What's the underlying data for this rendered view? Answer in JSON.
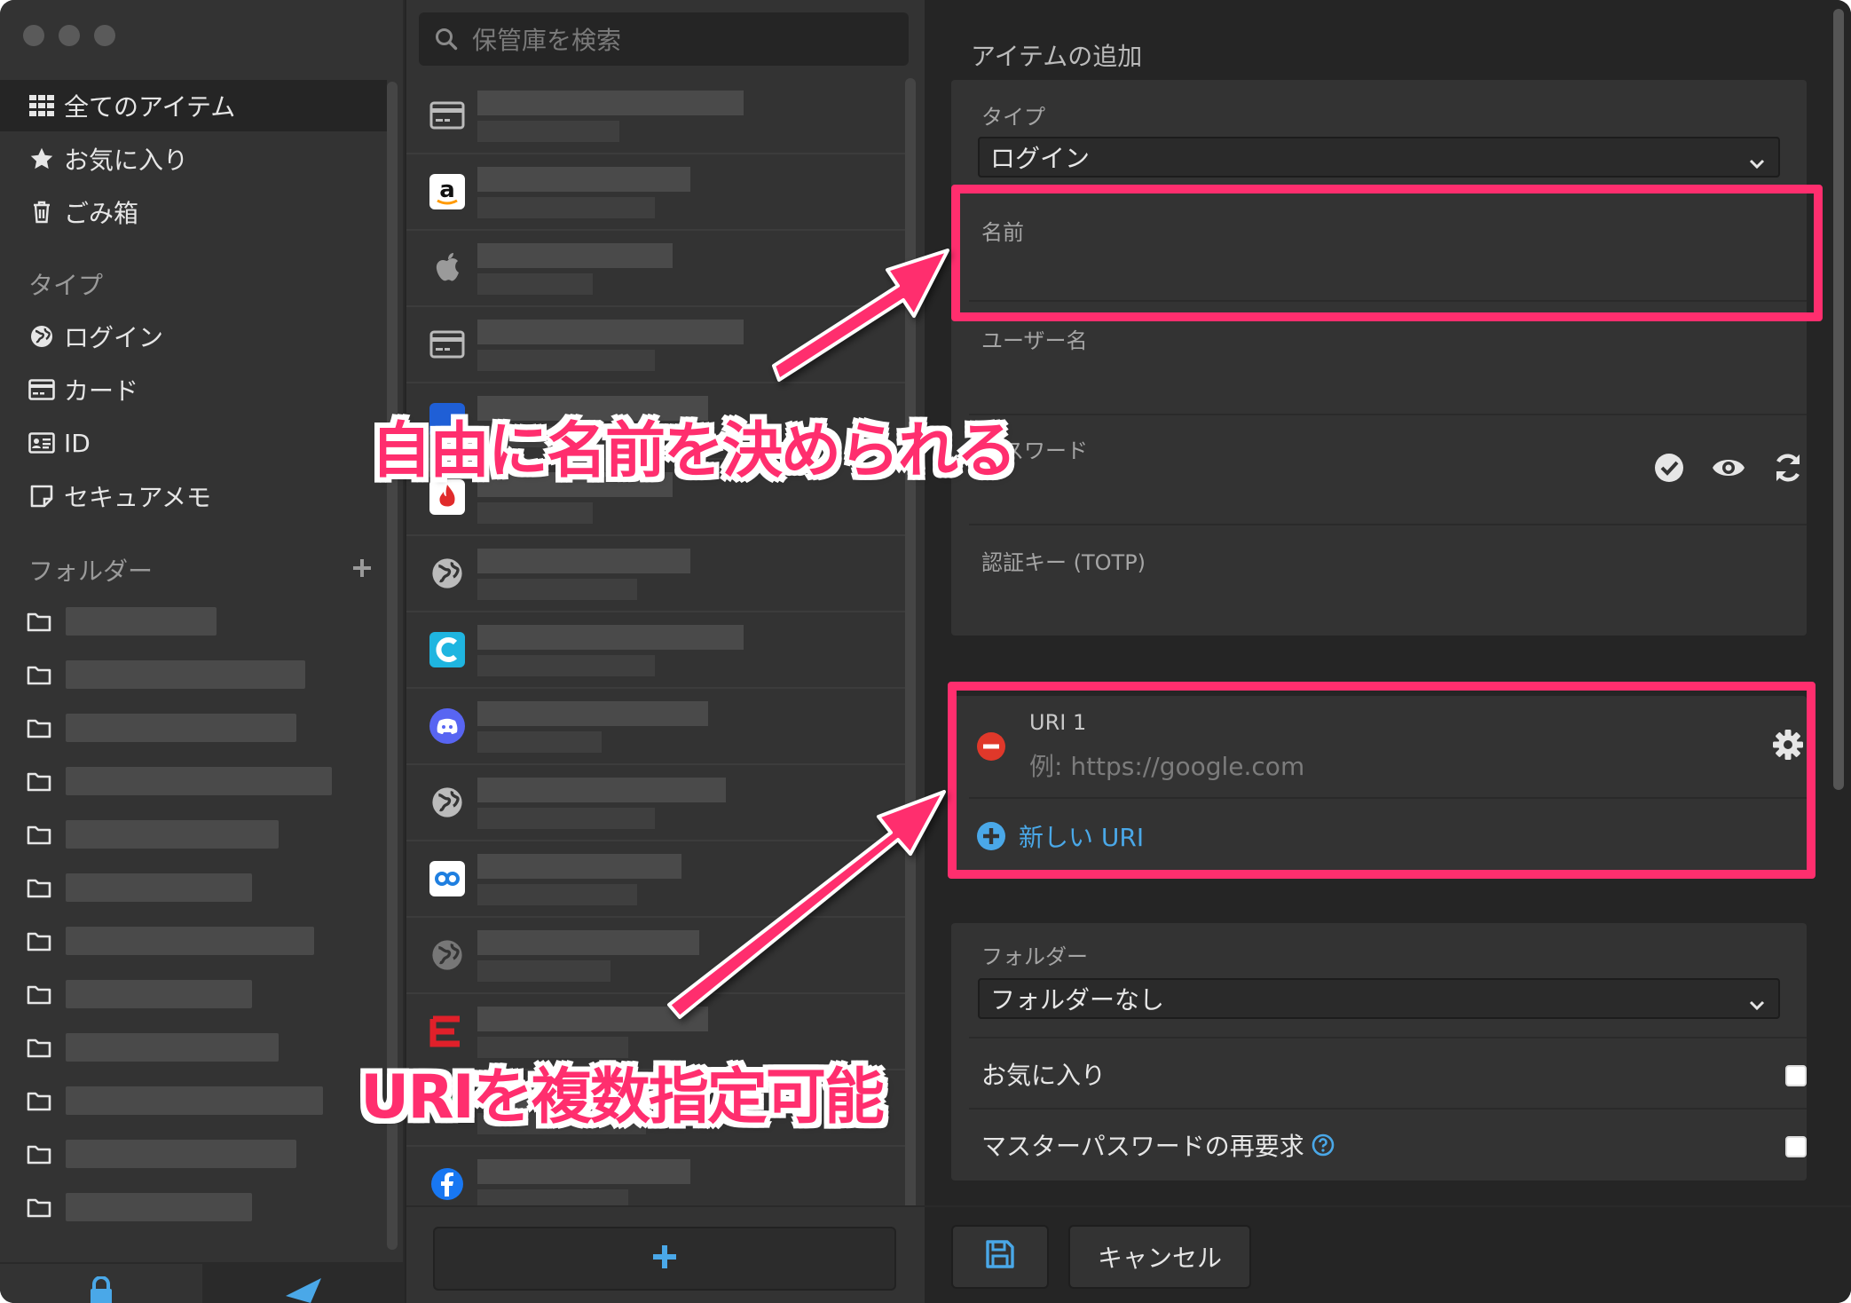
{
  "sidebar": {
    "items": [
      {
        "label": "全てのアイテム",
        "icon": "grid-icon"
      },
      {
        "label": "お気に入り",
        "icon": "star-icon"
      },
      {
        "label": "ごみ箱",
        "icon": "trash-icon"
      }
    ],
    "types_heading": "タイプ",
    "types": [
      {
        "label": "ログイン",
        "icon": "globe-icon"
      },
      {
        "label": "カード",
        "icon": "credit-card-icon"
      },
      {
        "label": "ID",
        "icon": "id-card-icon"
      },
      {
        "label": "セキュアメモ",
        "icon": "note-icon"
      }
    ],
    "folders_heading": "フォルダー",
    "folders_add": "+"
  },
  "list": {
    "search_placeholder": "保管庫を検索"
  },
  "detail": {
    "title": "アイテムの追加",
    "type_label": "タイプ",
    "type_value": "ログイン",
    "name_label": "名前",
    "username_label": "ユーザー名",
    "password_label": "パスワード",
    "totp_label": "認証キー (TOTP)",
    "uri_label": "URI 1",
    "uri_placeholder": "例: https://google.com",
    "new_uri": "新しい URI",
    "folder_label": "フォルダー",
    "folder_value": "フォルダーなし",
    "favorite_label": "お気に入り",
    "reprompt_label": "マスターパスワードの再要求",
    "cancel": "キャンセル"
  },
  "annotations": {
    "name_callout": "自由に名前を決められる",
    "uri_callout": "URIを複数指定可能"
  },
  "colors": {
    "highlight": "#ff2e6e",
    "link_blue": "#4aa8e8",
    "remove_red": "#e0382a",
    "background": "#252525",
    "panel": "#333333"
  }
}
